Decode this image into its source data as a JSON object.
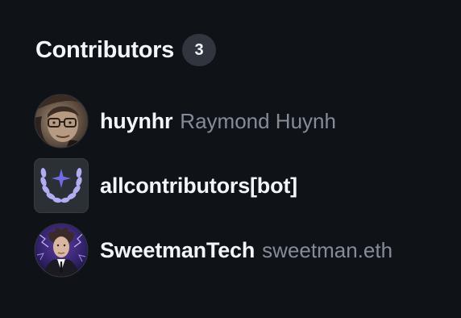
{
  "section": {
    "title": "Contributors",
    "count": "3"
  },
  "contributors": [
    {
      "login": "huynhr",
      "name": "Raymond Huynh",
      "avatar": "photo-avatar"
    },
    {
      "login": "allcontributors[bot]",
      "name": "",
      "avatar": "laurel-star-icon"
    },
    {
      "login": "SweetmanTech",
      "name": "sweetman.eth",
      "avatar": "photo-avatar"
    }
  ],
  "colors": {
    "background": "#0f1217",
    "text_primary": "#f0f6fc",
    "text_muted": "#848d97",
    "badge_bg": "#31363e",
    "bot_icon": "#a5a2ee"
  }
}
